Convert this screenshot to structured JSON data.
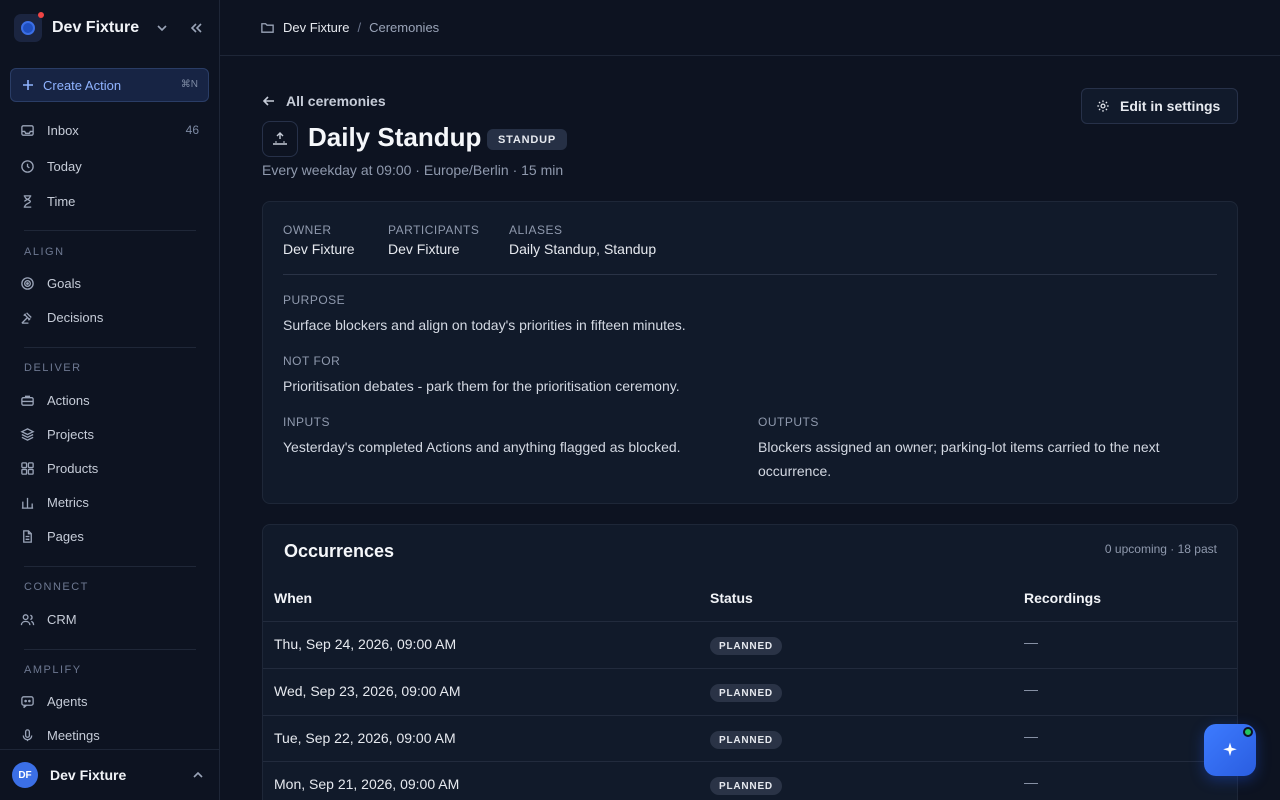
{
  "workspace": {
    "name": "Dev Fixture"
  },
  "sidebar": {
    "create_action": {
      "label": "Create Action",
      "shortcut": "⌘N"
    },
    "top_items": [
      {
        "label": "Inbox",
        "count": "46",
        "icon": "inbox-icon"
      },
      {
        "label": "Today",
        "icon": "clock-icon"
      },
      {
        "label": "Time",
        "icon": "hourglass-icon"
      }
    ],
    "sections": [
      {
        "label": "ALIGN",
        "items": [
          {
            "label": "Goals",
            "icon": "target-icon"
          },
          {
            "label": "Decisions",
            "icon": "gavel-icon"
          }
        ]
      },
      {
        "label": "DELIVER",
        "items": [
          {
            "label": "Actions",
            "icon": "briefcase-icon"
          },
          {
            "label": "Projects",
            "icon": "layers-icon"
          },
          {
            "label": "Products",
            "icon": "grid-icon"
          },
          {
            "label": "Metrics",
            "icon": "bar-chart-icon"
          },
          {
            "label": "Pages",
            "icon": "document-icon"
          }
        ]
      },
      {
        "label": "CONNECT",
        "items": [
          {
            "label": "CRM",
            "icon": "users-icon"
          }
        ]
      },
      {
        "label": "AMPLIFY",
        "items": [
          {
            "label": "Agents",
            "icon": "chat-bot-icon"
          },
          {
            "label": "Meetings",
            "icon": "microphone-icon"
          }
        ]
      }
    ],
    "user": {
      "initials": "DF",
      "name": "Dev Fixture"
    }
  },
  "breadcrumb": {
    "workspace": "Dev Fixture",
    "separator": "/",
    "current": "Ceremonies"
  },
  "header": {
    "back_label": "All ceremonies",
    "edit_label": "Edit in settings",
    "title": "Daily Standup",
    "badge": "STANDUP",
    "subtitle": "Every weekday at 09:00 · Europe/Berlin · 15 min"
  },
  "details": {
    "owner_label": "OWNER",
    "owner": "Dev Fixture",
    "participants_label": "PARTICIPANTS",
    "participants": "Dev Fixture",
    "aliases_label": "ALIASES",
    "aliases": "Daily Standup, Standup",
    "purpose_label": "PURPOSE",
    "purpose": "Surface blockers and align on today's priorities in fifteen minutes.",
    "not_for_label": "NOT FOR",
    "not_for": "Prioritisation debates - park them for the prioritisation ceremony.",
    "inputs_label": "INPUTS",
    "inputs": "Yesterday's completed Actions and anything flagged as blocked.",
    "outputs_label": "OUTPUTS",
    "outputs": "Blockers assigned an owner; parking-lot items carried to the next occurrence."
  },
  "occurrences": {
    "title": "Occurrences",
    "counts": "0 upcoming · 18 past",
    "columns": [
      "When",
      "Status",
      "Recordings"
    ],
    "rows": [
      {
        "when": "Thu, Sep 24, 2026, 09:00 AM",
        "status": "PLANNED",
        "recordings": "—"
      },
      {
        "when": "Wed, Sep 23, 2026, 09:00 AM",
        "status": "PLANNED",
        "recordings": "—"
      },
      {
        "when": "Tue, Sep 22, 2026, 09:00 AM",
        "status": "PLANNED",
        "recordings": "—"
      },
      {
        "when": "Mon, Sep 21, 2026, 09:00 AM",
        "status": "PLANNED",
        "recordings": "—"
      }
    ]
  },
  "colors": {
    "accent": "#3d7bff",
    "background": "#0d1321",
    "card": "#111a2a",
    "online": "#22c55e"
  }
}
